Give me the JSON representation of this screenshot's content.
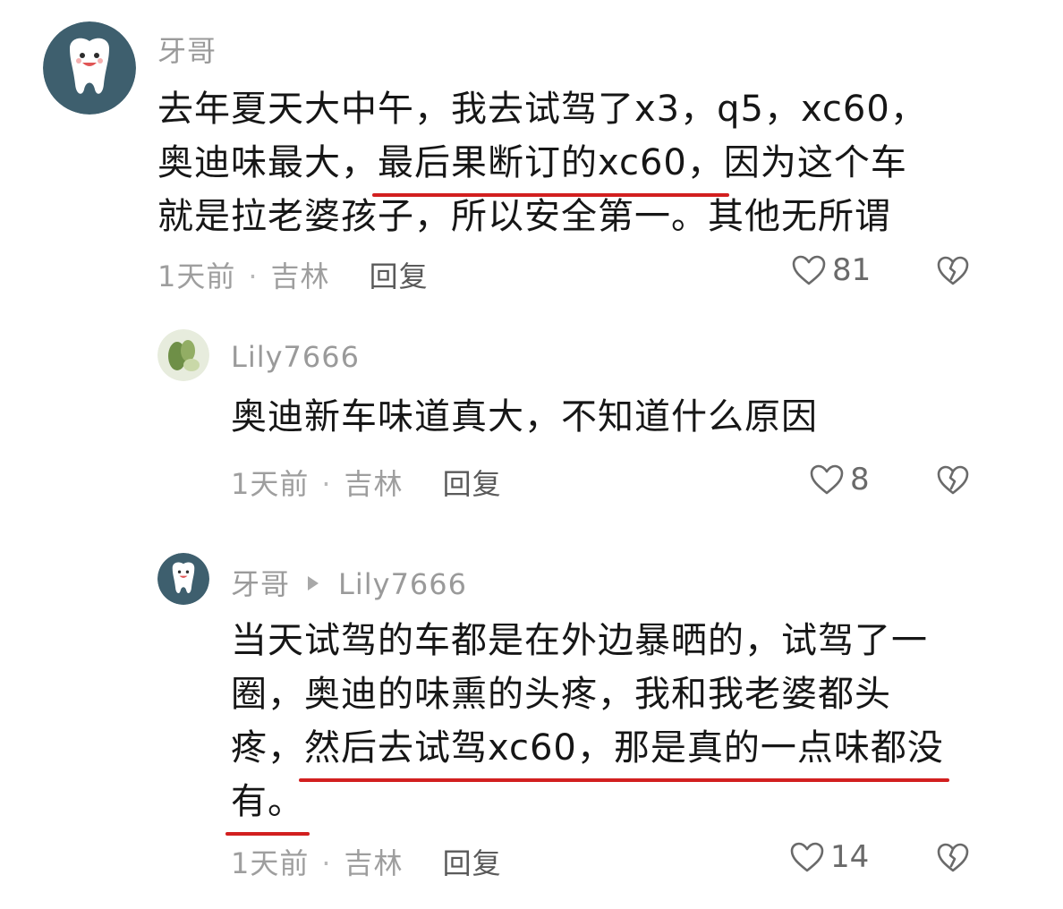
{
  "comments": [
    {
      "username": "牙哥",
      "lines": [
        [
          "去年夏天大中午，我去试驾了x3，q5，xc60，"
        ],
        [
          "奥迪味最大，",
          "最后果断订的xc60，",
          "因为这个车"
        ],
        [
          "就是拉老婆孩子，所以安全第一。其他无所谓"
        ]
      ],
      "time": "1天前",
      "location": "吉林",
      "reply_label": "回复",
      "likes": "81"
    },
    {
      "username": "Lily7666",
      "lines": [
        [
          "奥迪新车味道真大，不知道什么原因"
        ]
      ],
      "time": "1天前",
      "location": "吉林",
      "reply_label": "回复",
      "likes": "8"
    },
    {
      "username": "牙哥",
      "reply_to": "Lily7666",
      "lines": [
        [
          "当天试驾的车都是在外边暴晒的，试驾了一"
        ],
        [
          "圈，奥迪的味熏的头疼，我和我老婆都头"
        ],
        [
          "疼，",
          "然后去试驾xc60，那是真的一点味都没"
        ],
        [
          "有。"
        ]
      ],
      "time": "1天前",
      "location": "吉林",
      "reply_label": "回复",
      "likes": "14"
    }
  ],
  "separator": "·",
  "colors": {
    "underline": "#d21f1f",
    "avatar_bg": "#3e5f6e",
    "meta_text": "#9e9e9e"
  },
  "icons": {
    "like": "heart-outline-icon",
    "dislike": "broken-heart-icon",
    "reply_arrow": "triangle-right-icon"
  }
}
